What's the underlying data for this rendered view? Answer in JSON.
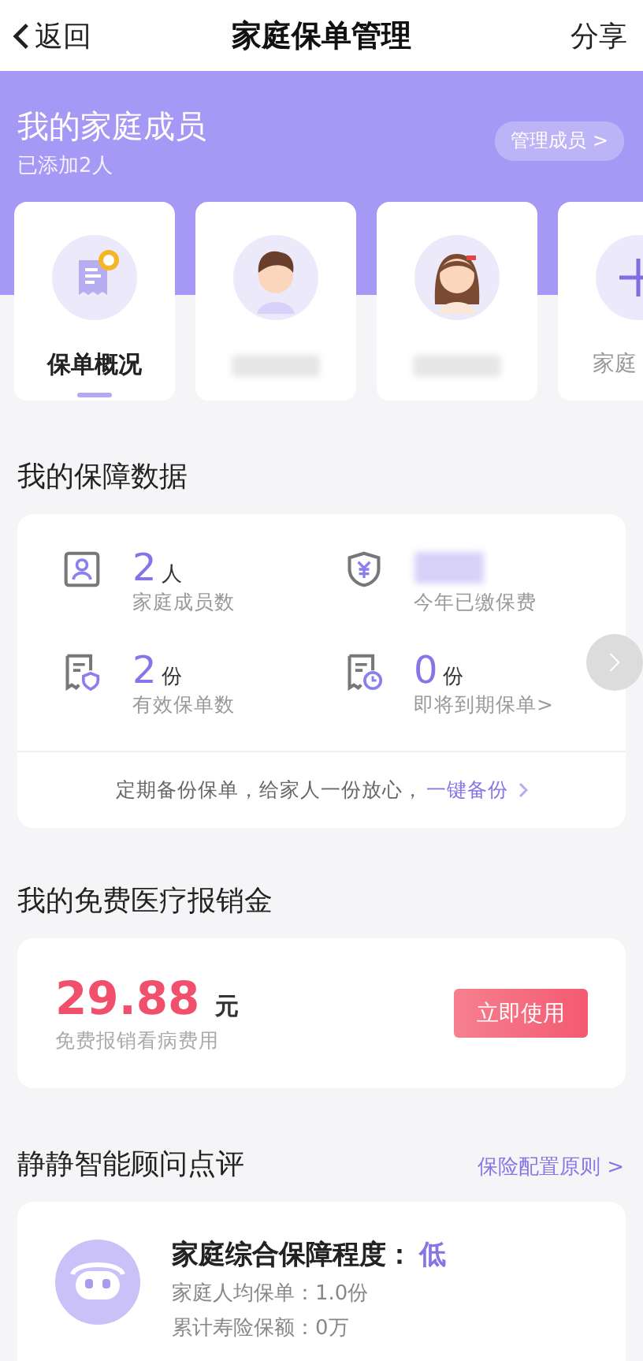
{
  "nav": {
    "back": "返回",
    "title": "家庭保单管理",
    "action": "分享"
  },
  "family": {
    "title": "我的家庭成员",
    "subtitle": "已添加2人",
    "manage": "管理成员 >",
    "members": [
      {
        "kind": "overview",
        "label": "保单概况",
        "selected": true
      },
      {
        "kind": "male",
        "selected": false
      },
      {
        "kind": "female",
        "selected": false
      },
      {
        "kind": "add",
        "label": "家庭",
        "selected": false
      }
    ]
  },
  "coverage": {
    "title": "我的保障数据",
    "stats": [
      {
        "kind": "members",
        "value": "2",
        "unit": "人",
        "label": "家庭成员数"
      },
      {
        "kind": "premium",
        "label": "今年已缴保费"
      },
      {
        "kind": "policies",
        "value": "2",
        "unit": "份",
        "label": "有效保单数"
      },
      {
        "kind": "expiring",
        "value": "0",
        "unit": "份",
        "label": "即将到期保单>"
      }
    ],
    "footer": "定期备份保单，给家人一份放心，",
    "link": "一键备份"
  },
  "medical": {
    "title": "我的免费医疗报销金",
    "amount": "29.88",
    "unit": "元",
    "note": "免费报销看病费用",
    "button": "立即使用"
  },
  "advisor": {
    "title": "静静智能顾问点评",
    "link": "保险配置原则 >",
    "heading": "家庭综合保障程度：",
    "rating": "低",
    "lines": [
      "家庭人均保单：1.0份",
      "累计寿险保额：0万"
    ]
  }
}
